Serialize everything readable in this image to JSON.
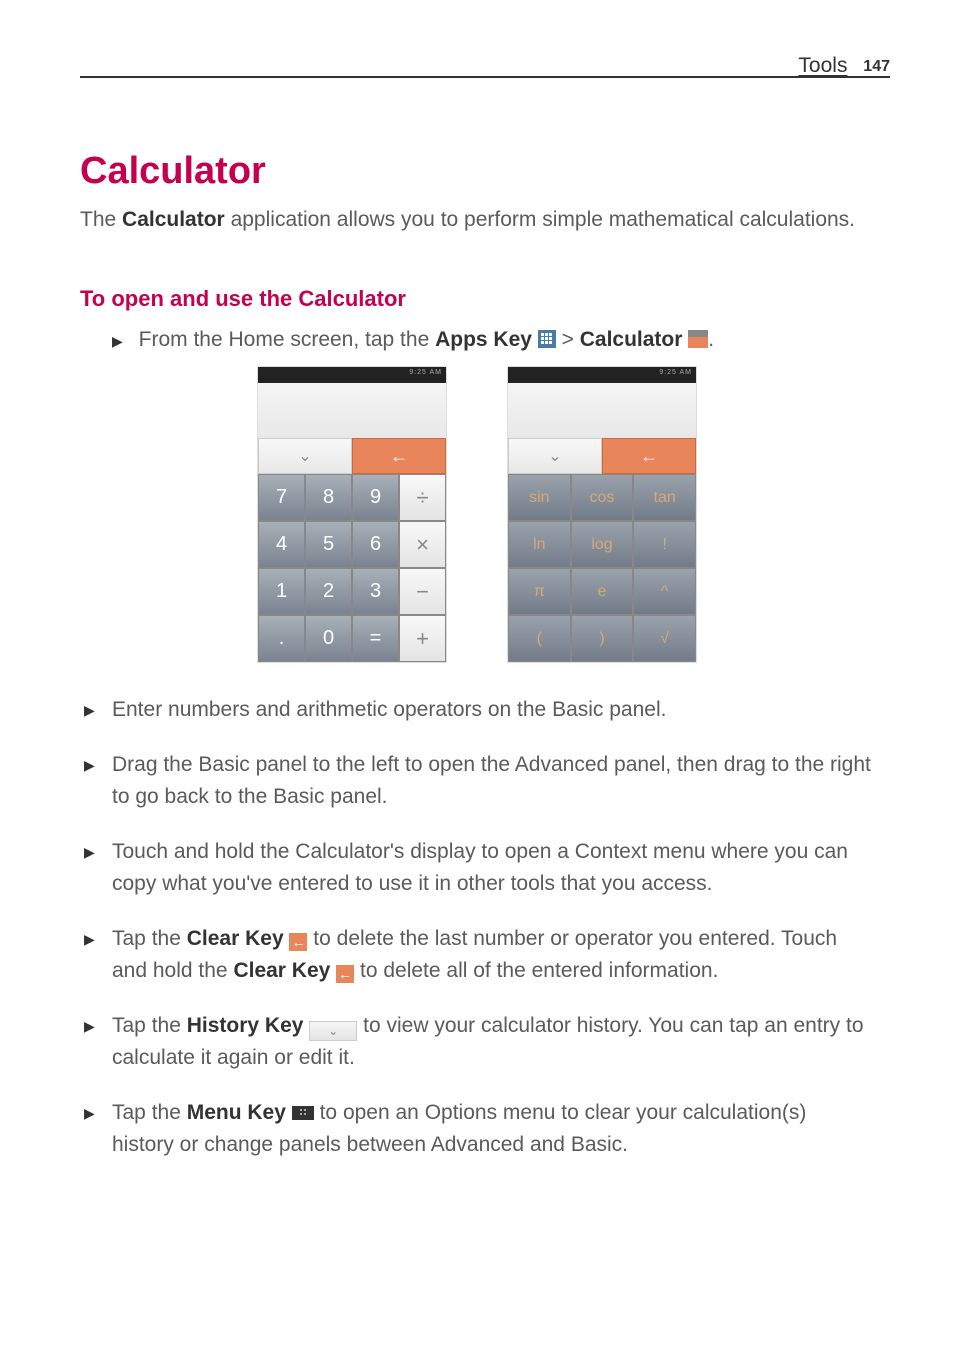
{
  "header": {
    "section": "Tools",
    "page": "147"
  },
  "title": "Calculator",
  "intro_parts": {
    "p1": "The ",
    "bold1": "Calculator",
    "p2": " application allows you to perform simple mathematical calculations."
  },
  "subheading": "To open and use the Calculator",
  "step": {
    "p1": "From the Home screen, tap the ",
    "bold1": "Apps Key",
    "mid": " > ",
    "bold2": "Calculator",
    "end": "."
  },
  "basic_panel": {
    "status": "9:25 AM",
    "history_sym": "⌄",
    "clear_sym": "←",
    "keys": [
      "7",
      "8",
      "9",
      "÷",
      "4",
      "5",
      "6",
      "×",
      "1",
      "2",
      "3",
      "−",
      ".",
      "0",
      "=",
      "+"
    ]
  },
  "adv_panel": {
    "status": "9:25 AM",
    "history_sym": "⌄",
    "clear_sym": "←",
    "keys": [
      "sin",
      "cos",
      "tan",
      "ln",
      "log",
      "!",
      "π",
      "e",
      "^",
      "(",
      ")",
      "√"
    ]
  },
  "bullets": {
    "b1": "Enter numbers and arithmetic operators on the Basic panel.",
    "b2": "Drag the Basic panel to the left to open the Advanced panel, then drag to the right to go back to the Basic panel.",
    "b3": "Touch and hold the Calculator's display to open a Context menu where you can copy what you've entered to use it in other tools that you access.",
    "b4": {
      "p1": "Tap the ",
      "bold1": "Clear Key",
      "p2": " to delete the last number or operator you entered. Touch and hold the ",
      "bold2": "Clear Key",
      "p3": " to delete all of the entered information."
    },
    "b5": {
      "p1": "Tap the ",
      "bold1": "History Key",
      "p2": " to view your calculator history. You can tap an entry to calculate it again or edit it."
    },
    "b6": {
      "p1": "Tap the ",
      "bold1": "Menu Key",
      "p2": " to open an Options menu to clear your calculation(s) history or change panels between Advanced and Basic."
    }
  }
}
